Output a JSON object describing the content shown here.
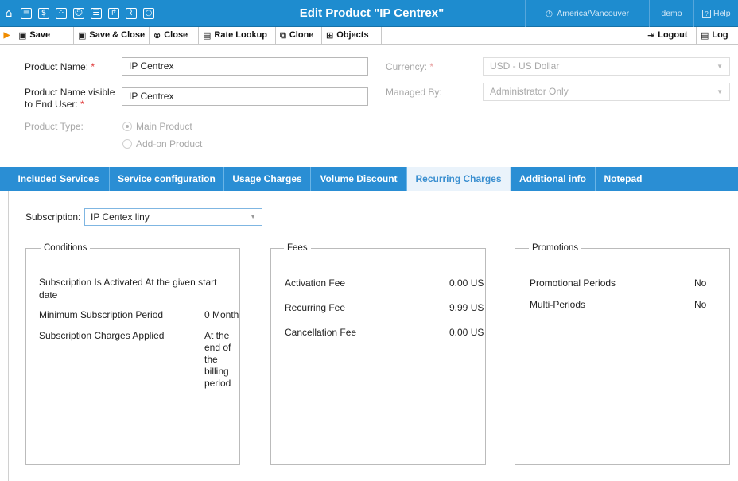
{
  "header": {
    "title": "Edit Product \"IP Centrex\"",
    "timezone": "America/Vancouver",
    "user": "demo",
    "help": "Help",
    "icons": [
      "home-icon",
      "list-icon",
      "dollar-icon",
      "network-icon",
      "person-icon",
      "phonebook-icon",
      "forward-icon",
      "chart-icon",
      "search-icon"
    ]
  },
  "toolbar": {
    "save": "Save",
    "save_close": "Save & Close",
    "close": "Close",
    "rate_lookup": "Rate Lookup",
    "clone": "Clone",
    "objects": "Objects",
    "logout": "Logout",
    "log": "Log"
  },
  "form": {
    "product_name_label": "Product Name:",
    "product_name_value": "IP Centrex",
    "product_name_visible_label_1": "Product Name visible",
    "product_name_visible_label_2": "to End User:",
    "product_name_visible_value": "IP Centrex",
    "product_type_label": "Product Type:",
    "main_product": "Main Product",
    "addon_product": "Add-on Product",
    "currency_label": "Currency:",
    "currency_value": "USD - US Dollar",
    "managed_by_label": "Managed By:",
    "managed_by_value": "Administrator Only",
    "required_mark": "*"
  },
  "tabs": [
    {
      "label": "Included Services",
      "active": false
    },
    {
      "label": "Service configuration",
      "active": false
    },
    {
      "label": "Usage Charges",
      "active": false
    },
    {
      "label": "Volume Discount",
      "active": false
    },
    {
      "label": "Recurring Charges",
      "active": true
    },
    {
      "label": "Additional info",
      "active": false
    },
    {
      "label": "Notepad",
      "active": false
    }
  ],
  "subscription": {
    "label": "Subscription:",
    "value": "IP Centex liny"
  },
  "conditions": {
    "legend": "Conditions",
    "activated_1": "Subscription Is Activated At the given start",
    "activated_2": "date",
    "min_period_label": "Minimum Subscription Period",
    "min_period_value": "0 Month",
    "charges_label": "Subscription Charges Applied",
    "charges_value": [
      "At the",
      "end of",
      "the",
      "billing",
      "period"
    ]
  },
  "fees": {
    "legend": "Fees",
    "activation_label": "Activation Fee",
    "activation_value": "0.00 US",
    "recurring_label": "Recurring Fee",
    "recurring_value": "9.99 US",
    "cancellation_label": "Cancellation Fee",
    "cancellation_value": "0.00 US"
  },
  "promotions": {
    "legend": "Promotions",
    "promotional_label": "Promotional Periods",
    "promotional_value": "No",
    "multi_label": "Multi-Periods",
    "multi_value": "No"
  },
  "colors": {
    "accent": "#1e8ccf",
    "tab_bar": "#2a8ed4",
    "active_tab_text": "#3a8fd0",
    "required": "#e03a3a"
  }
}
